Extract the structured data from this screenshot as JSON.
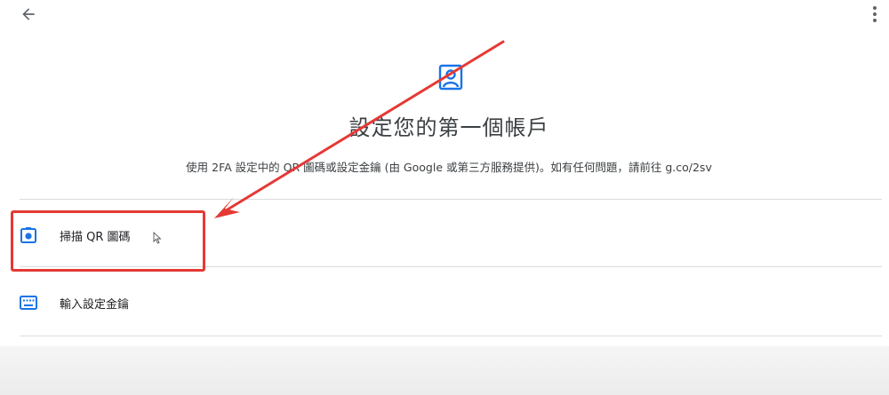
{
  "header": {
    "back_icon": "arrow-back-icon",
    "menu_icon": "more-vert-icon"
  },
  "hero": {
    "icon": "account-box-icon",
    "title": "設定您的第一個帳戶",
    "subtitle": "使用 2FA 設定中的 QR 圖碼或設定金鑰 (由 Google 或第三方服務提供)。如有任何問題，請前往 g.co/2sv"
  },
  "options": [
    {
      "icon": "camera-icon",
      "label": "掃描 QR 圖碼"
    },
    {
      "icon": "keyboard-icon",
      "label": "輸入設定金鑰"
    }
  ],
  "colors": {
    "accent": "#1a73e8",
    "annotation": "#e53935",
    "divider": "#dadce0"
  }
}
